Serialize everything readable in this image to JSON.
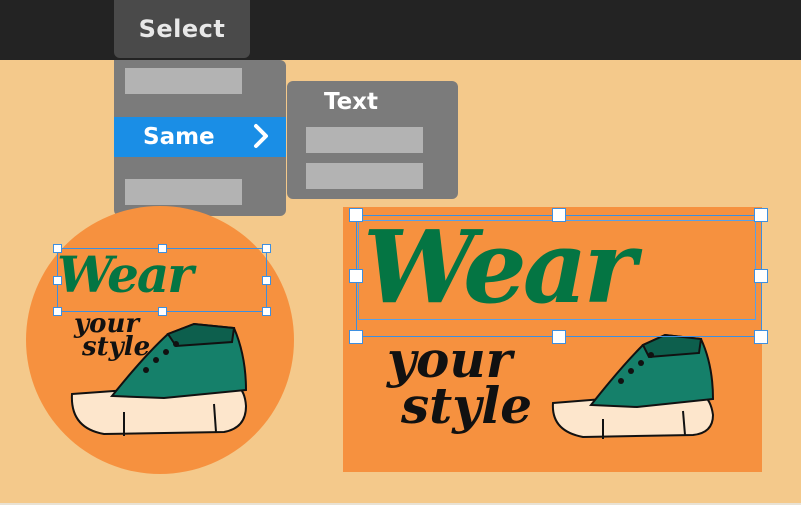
{
  "toolbar": {
    "menu_label": "Select"
  },
  "menu": {
    "active_item": "Same"
  },
  "submenu": {
    "title": "Text"
  },
  "artwork": {
    "headline": "Wear",
    "tagline_line1": "your",
    "tagline_line2": "style"
  },
  "colors": {
    "background": "#f4c98b",
    "menu_bar": "#232323",
    "menu_panel": "#7b7b7b",
    "highlight": "#1a8ee6",
    "artboard": "#f6913f",
    "headline": "#047543",
    "selection": "#3d8fe0"
  },
  "icons": {
    "submenu_arrow": "chevron-right-icon",
    "artwork_shoe": "sneaker-icon"
  }
}
